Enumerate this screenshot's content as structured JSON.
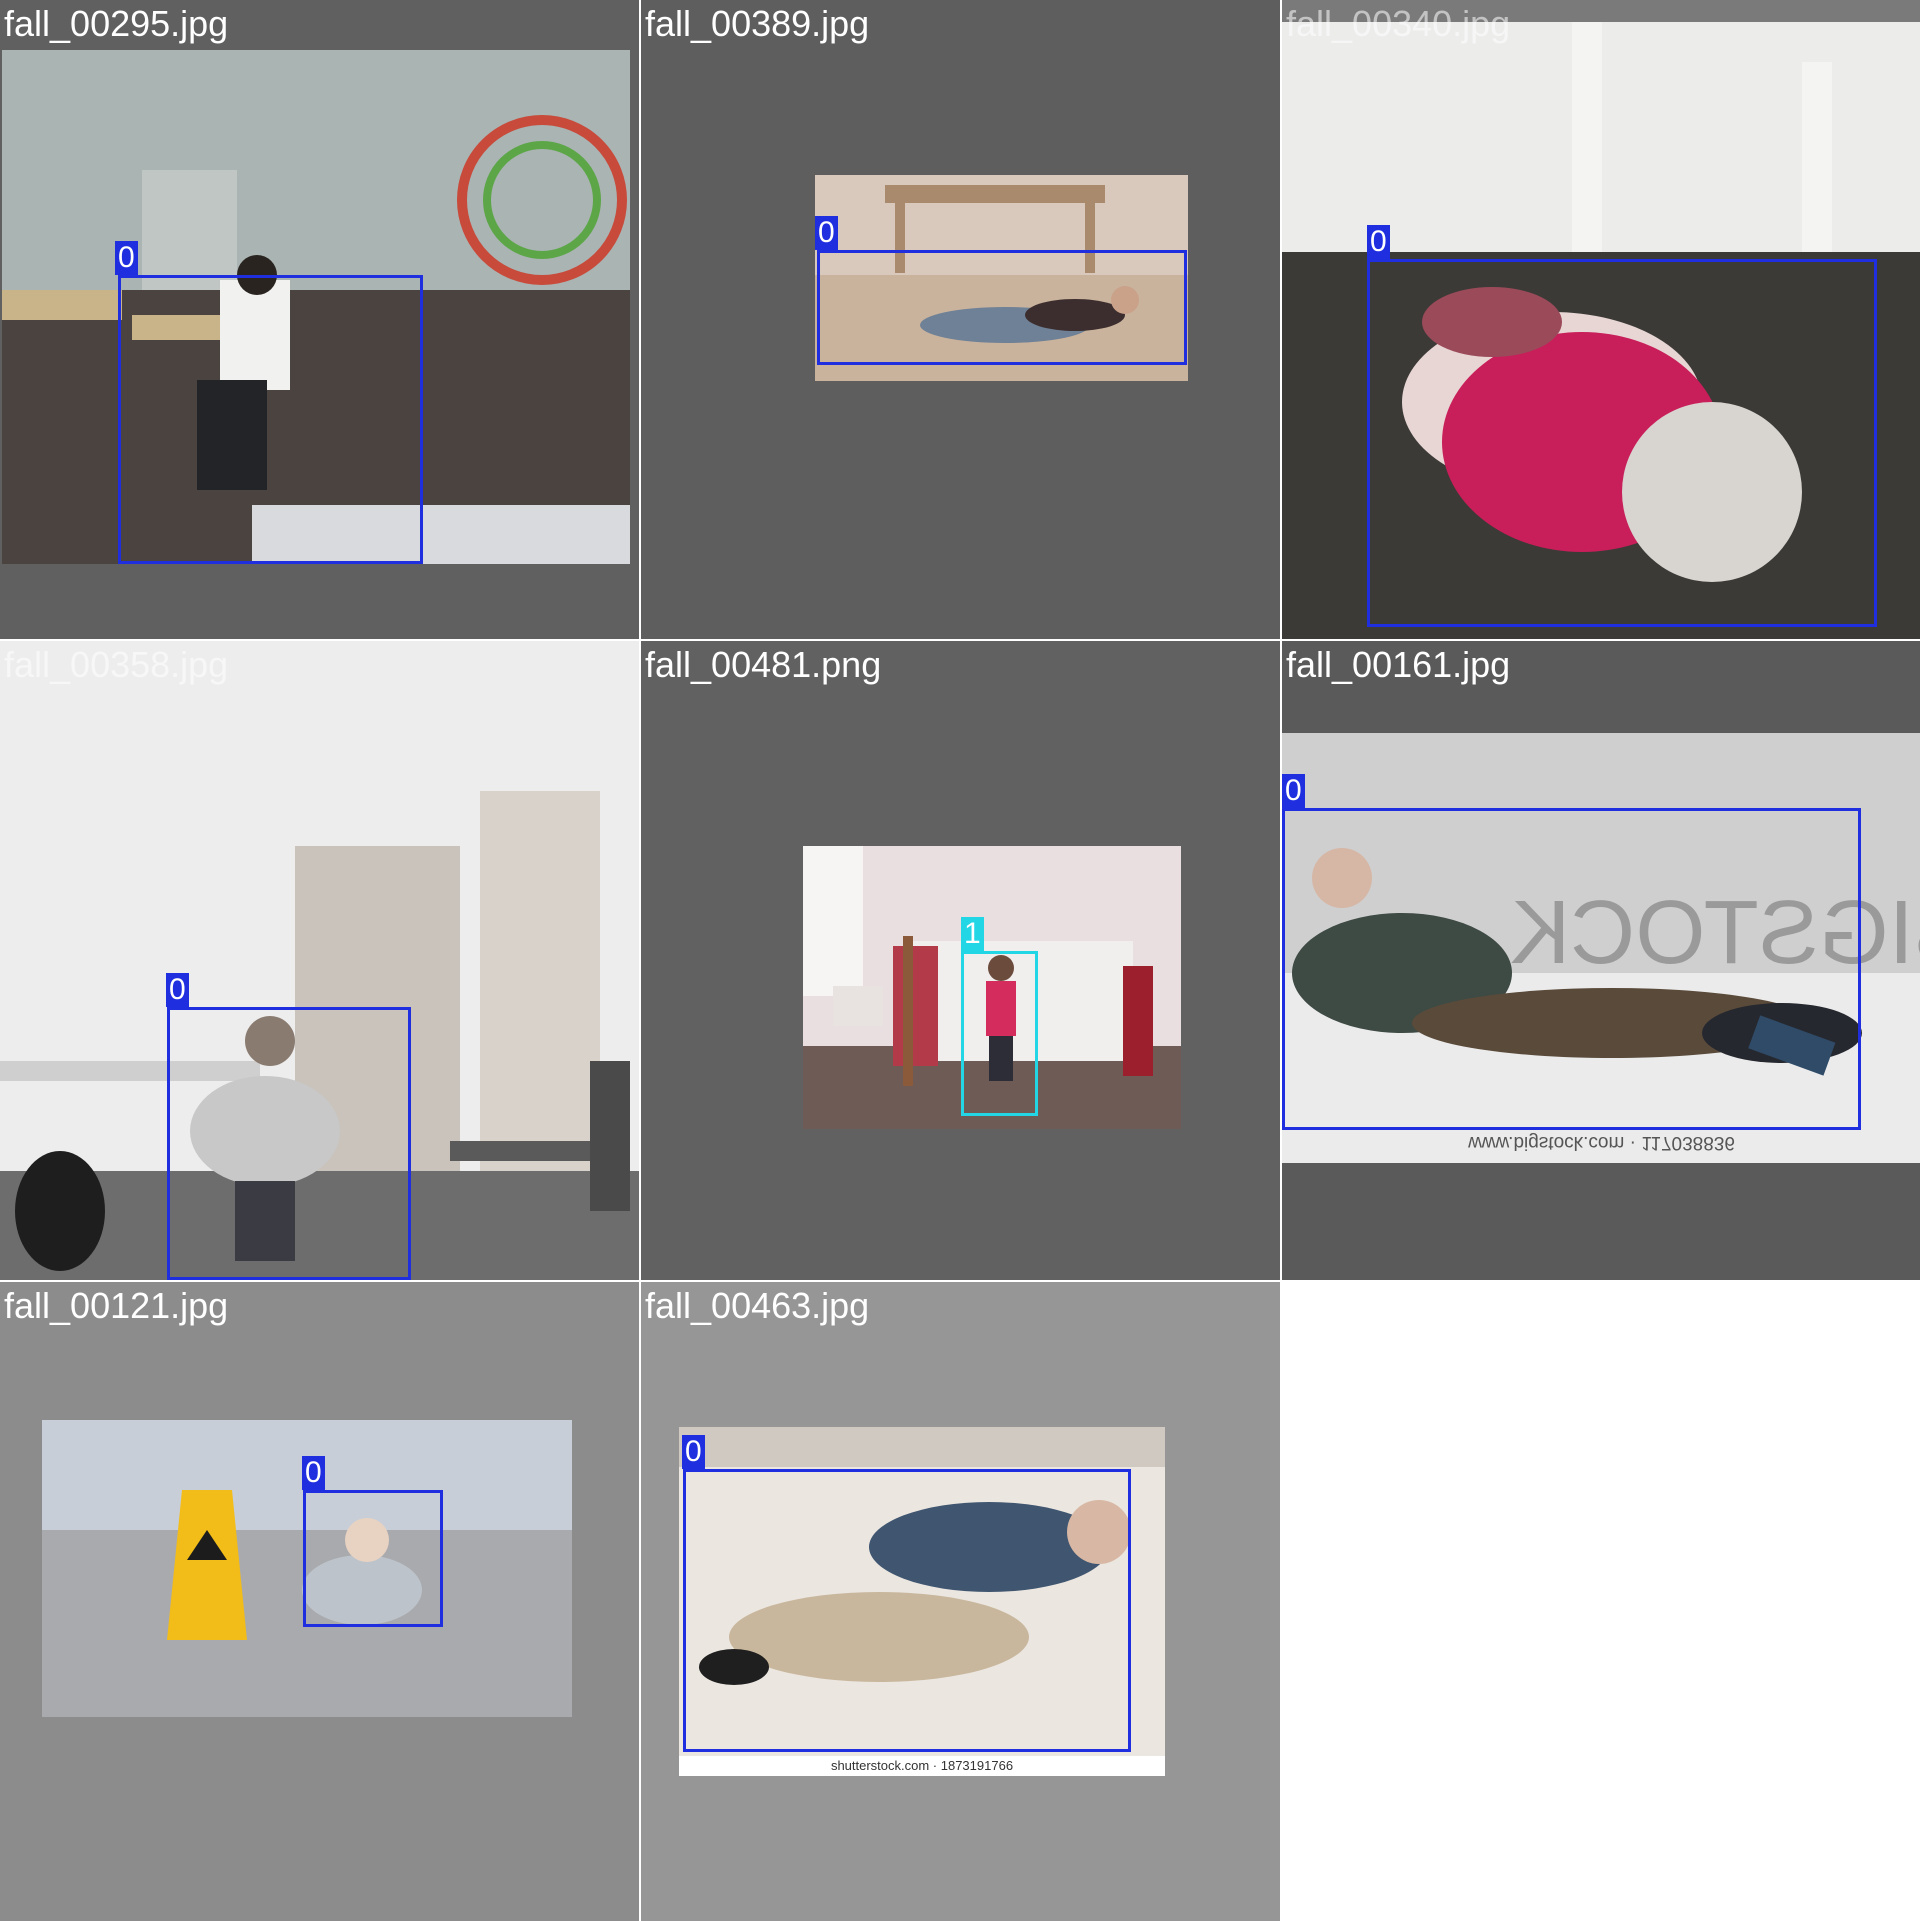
{
  "colors": {
    "class_0": "#1f2fe0",
    "class_1": "#22d6e6",
    "grid_line": "#ffffff"
  },
  "tiles": [
    {
      "filename": "fall_00295.jpg",
      "labels": [
        "0"
      ]
    },
    {
      "filename": "fall_00389.jpg",
      "labels": [
        "0"
      ]
    },
    {
      "filename": "fall_00340.jpg",
      "labels": [
        "0"
      ]
    },
    {
      "filename": "fall_00358.jpg",
      "labels": [
        "0"
      ]
    },
    {
      "filename": "fall_00481.png",
      "labels": [
        "1"
      ]
    },
    {
      "filename": "fall_00161.jpg",
      "labels": [
        "0"
      ]
    },
    {
      "filename": "fall_00121.jpg",
      "labels": [
        "0"
      ]
    },
    {
      "filename": "fall_00463.jpg",
      "labels": [
        "0"
      ]
    }
  ],
  "watermarks": {
    "bigstock_mirrored": "BIGSTOCK",
    "bigstock_footer": "www.bigstock.com · 117038836",
    "shutterstock_footer": "shutterstock.com · 1873191766"
  }
}
